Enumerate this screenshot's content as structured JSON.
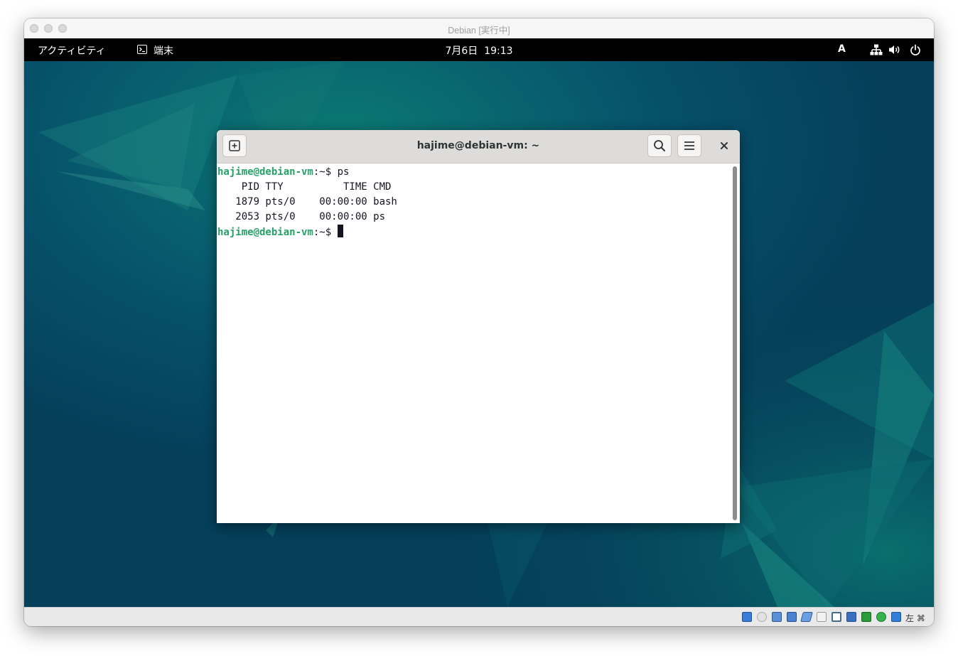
{
  "host_window": {
    "title": "Debian [実行中]"
  },
  "gnome_bar": {
    "activities": "アクティビティ",
    "app_label": "端末",
    "clock": "7月6日  19:13",
    "input_method": "A"
  },
  "terminal": {
    "title": "hajime@debian-vm: ~",
    "lines": [
      {
        "user": "hajime@debian-vm",
        "rest": ":~$ ps"
      },
      {
        "text": "    PID TTY          TIME CMD"
      },
      {
        "text": "   1879 pts/0    00:00:00 bash"
      },
      {
        "text": "   2053 pts/0    00:00:00 ps"
      },
      {
        "user": "hajime@debian-vm",
        "rest": ":~$ "
      }
    ],
    "colors": {
      "prompt": "#26a269",
      "text": "#171421"
    }
  },
  "status_bar": {
    "host_key": "左 ⌘",
    "icons": [
      "hard-disk-icon",
      "optical-drive-icon",
      "audio-icon",
      "network-icon",
      "usb-icon",
      "shared-folder-icon",
      "display-icon",
      "recording-icon",
      "cpu-icon",
      "mouse-integration-icon",
      "keyboard-capture-icon"
    ]
  }
}
